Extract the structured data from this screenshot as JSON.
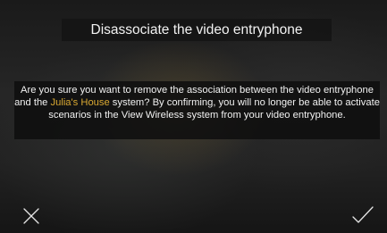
{
  "dialog": {
    "title": "Disassociate the video entryphone",
    "message": {
      "part1": "Are you sure you want to remove the association between the video entryphone and the ",
      "system_name": "Julia's House",
      "part2": " system? By confirming, you will no longer be able to activate scenarios in the View Wireless system from your video entryphone."
    },
    "cancel_icon": "close-icon",
    "confirm_icon": "checkmark-icon"
  },
  "colors": {
    "text": "#f2f2f2",
    "highlight": "#d9a832",
    "panel": "#141414"
  }
}
